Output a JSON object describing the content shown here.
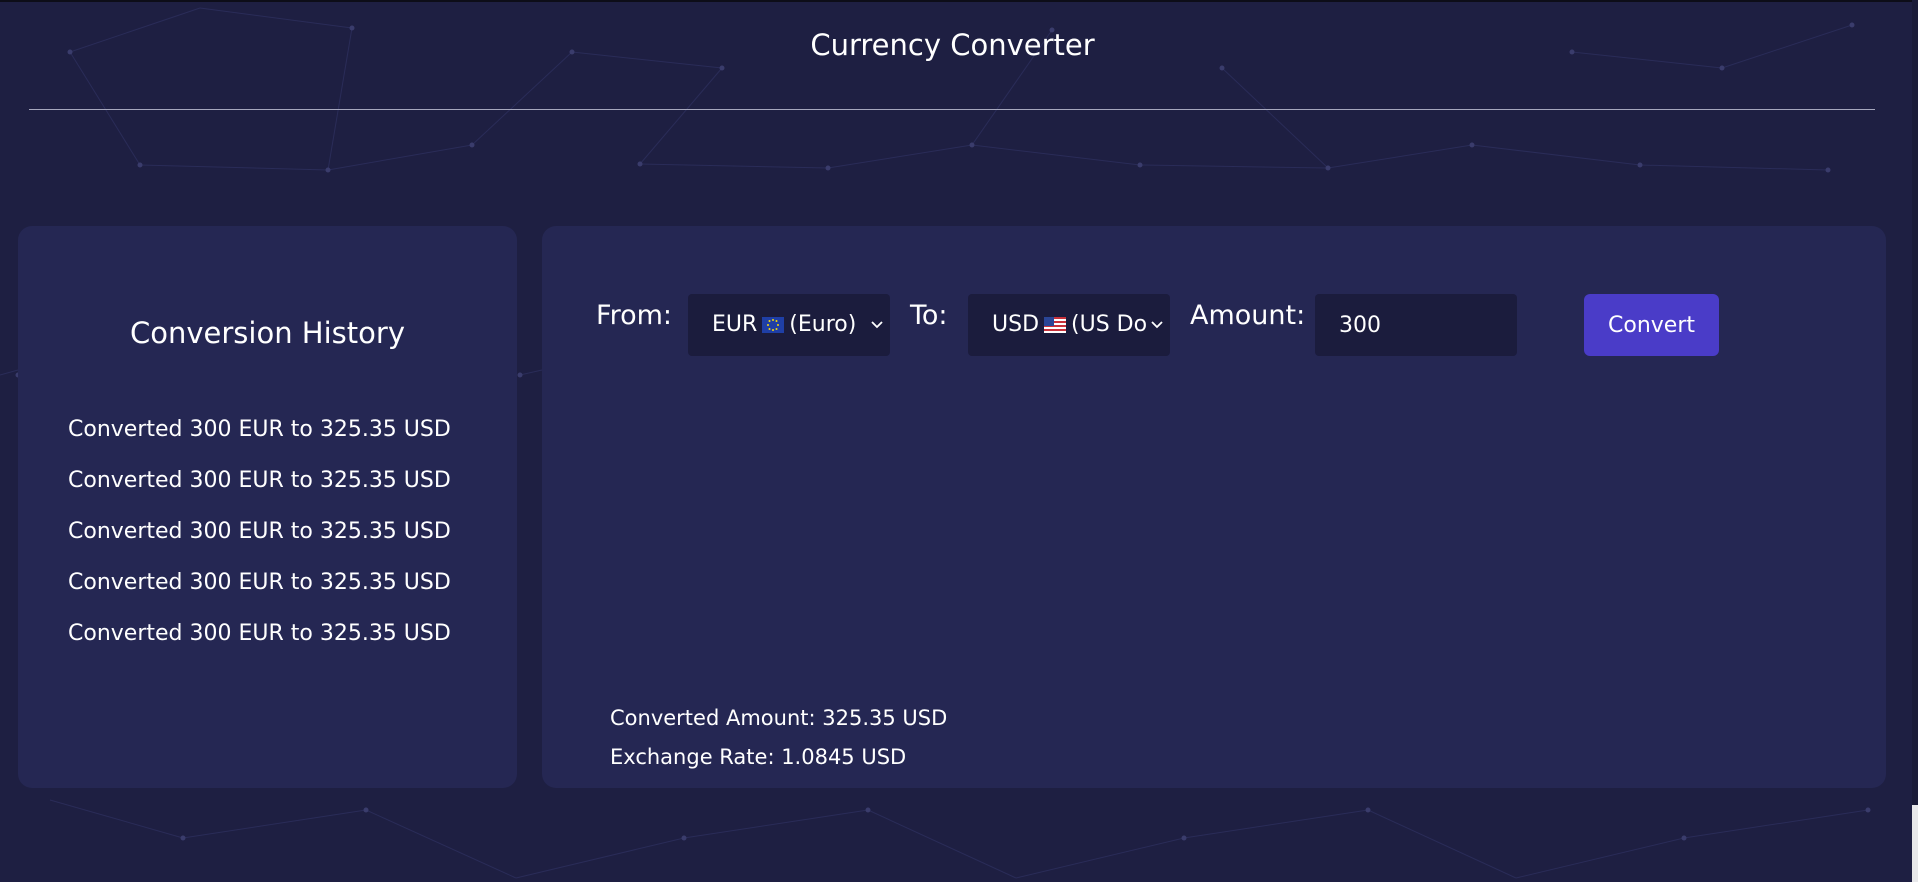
{
  "page": {
    "title": "Currency Converter"
  },
  "history": {
    "title": "Conversion History",
    "items": [
      "Converted 300 EUR to 325.35 USD",
      "Converted 300 EUR to 325.35 USD",
      "Converted 300 EUR to 325.35 USD",
      "Converted 300 EUR to 325.35 USD",
      "Converted 300 EUR to 325.35 USD"
    ]
  },
  "converter": {
    "from_label": "From:",
    "from_code": "EUR",
    "from_name": "(Euro)",
    "from_flag_icon": "eu-flag-icon",
    "to_label": "To:",
    "to_code": "USD",
    "to_name": "(US Dol",
    "to_flag_icon": "us-flag-icon",
    "amount_label": "Amount:",
    "amount_value": "300",
    "convert_label": "Convert",
    "result_amount": "Converted Amount: 325.35 USD",
    "result_rate": "Exchange Rate: 1.0845 USD"
  },
  "colors": {
    "background": "#1e1f42",
    "panel": "#252753",
    "field": "#1b1c3d",
    "accent": "#4a3cc8",
    "rule": "#a6a7bd"
  }
}
